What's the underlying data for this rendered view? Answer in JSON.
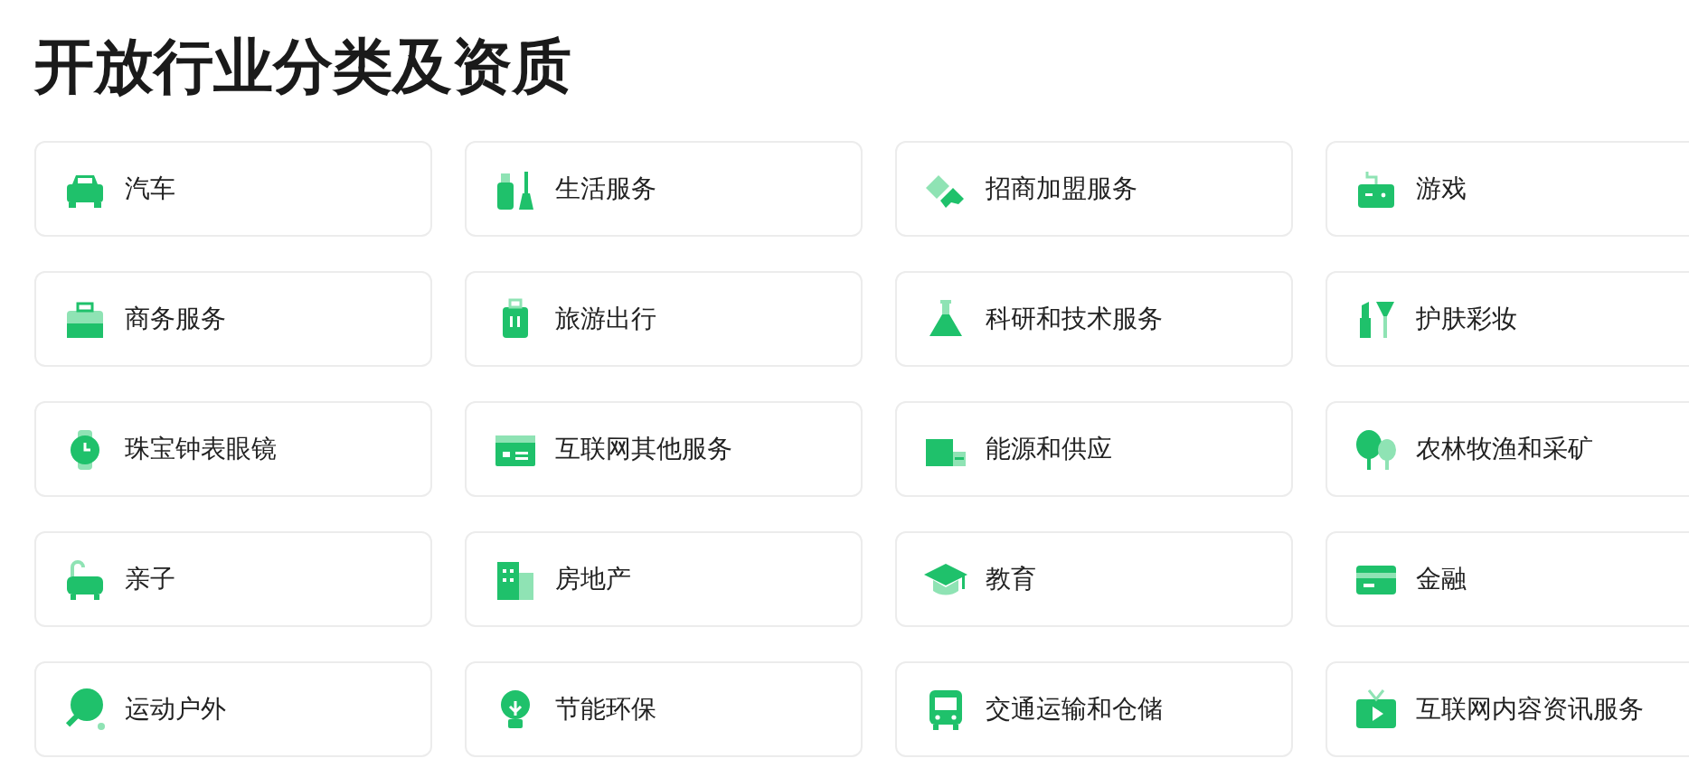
{
  "title": "开放行业分类及资质",
  "categories": [
    {
      "label": "汽车"
    },
    {
      "label": "生活服务"
    },
    {
      "label": "招商加盟服务"
    },
    {
      "label": "游戏"
    },
    {
      "label": "商务服务"
    },
    {
      "label": "旅游出行"
    },
    {
      "label": "科研和技术服务"
    },
    {
      "label": "护肤彩妆"
    },
    {
      "label": "珠宝钟表眼镜"
    },
    {
      "label": "互联网其他服务"
    },
    {
      "label": "能源和供应"
    },
    {
      "label": "农林牧渔和采矿"
    },
    {
      "label": "亲子"
    },
    {
      "label": "房地产"
    },
    {
      "label": "教育"
    },
    {
      "label": "金融"
    },
    {
      "label": "运动户外"
    },
    {
      "label": "节能环保"
    },
    {
      "label": "交通运输和仓储"
    },
    {
      "label": "互联网内容资讯服务"
    }
  ]
}
